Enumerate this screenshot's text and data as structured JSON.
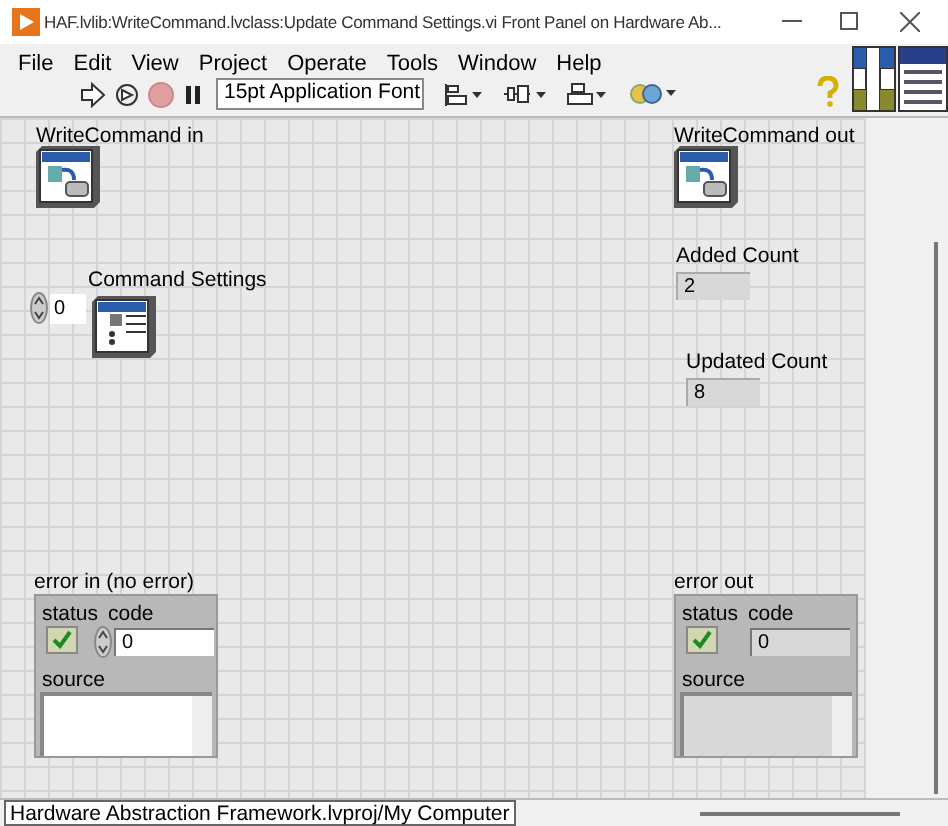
{
  "window": {
    "title": "HAF.lvlib:WriteCommand.lvclass:Update Command Settings.vi Front Panel on Hardware Ab..."
  },
  "menu": [
    "File",
    "Edit",
    "View",
    "Project",
    "Operate",
    "Tools",
    "Window",
    "Help"
  ],
  "toolbar": {
    "font": "15pt Application Font"
  },
  "write_command_in": {
    "label": "WriteCommand in"
  },
  "command_settings": {
    "label": "Command Settings",
    "index": "0"
  },
  "write_command_out": {
    "label": "WriteCommand out"
  },
  "added_count": {
    "label": "Added Count",
    "value": "2"
  },
  "updated_count": {
    "label": "Updated Count",
    "value": "8"
  },
  "error_in": {
    "label": "error in (no error)",
    "status_label": "status",
    "status": false,
    "code_label": "code",
    "code": "0",
    "source_label": "source"
  },
  "error_out": {
    "label": "error out",
    "status_label": "status",
    "status": false,
    "code_label": "code",
    "code": "0",
    "source_label": "source"
  },
  "status_bar": {
    "path": "Hardware Abstraction Framework.lvproj/My Computer"
  }
}
